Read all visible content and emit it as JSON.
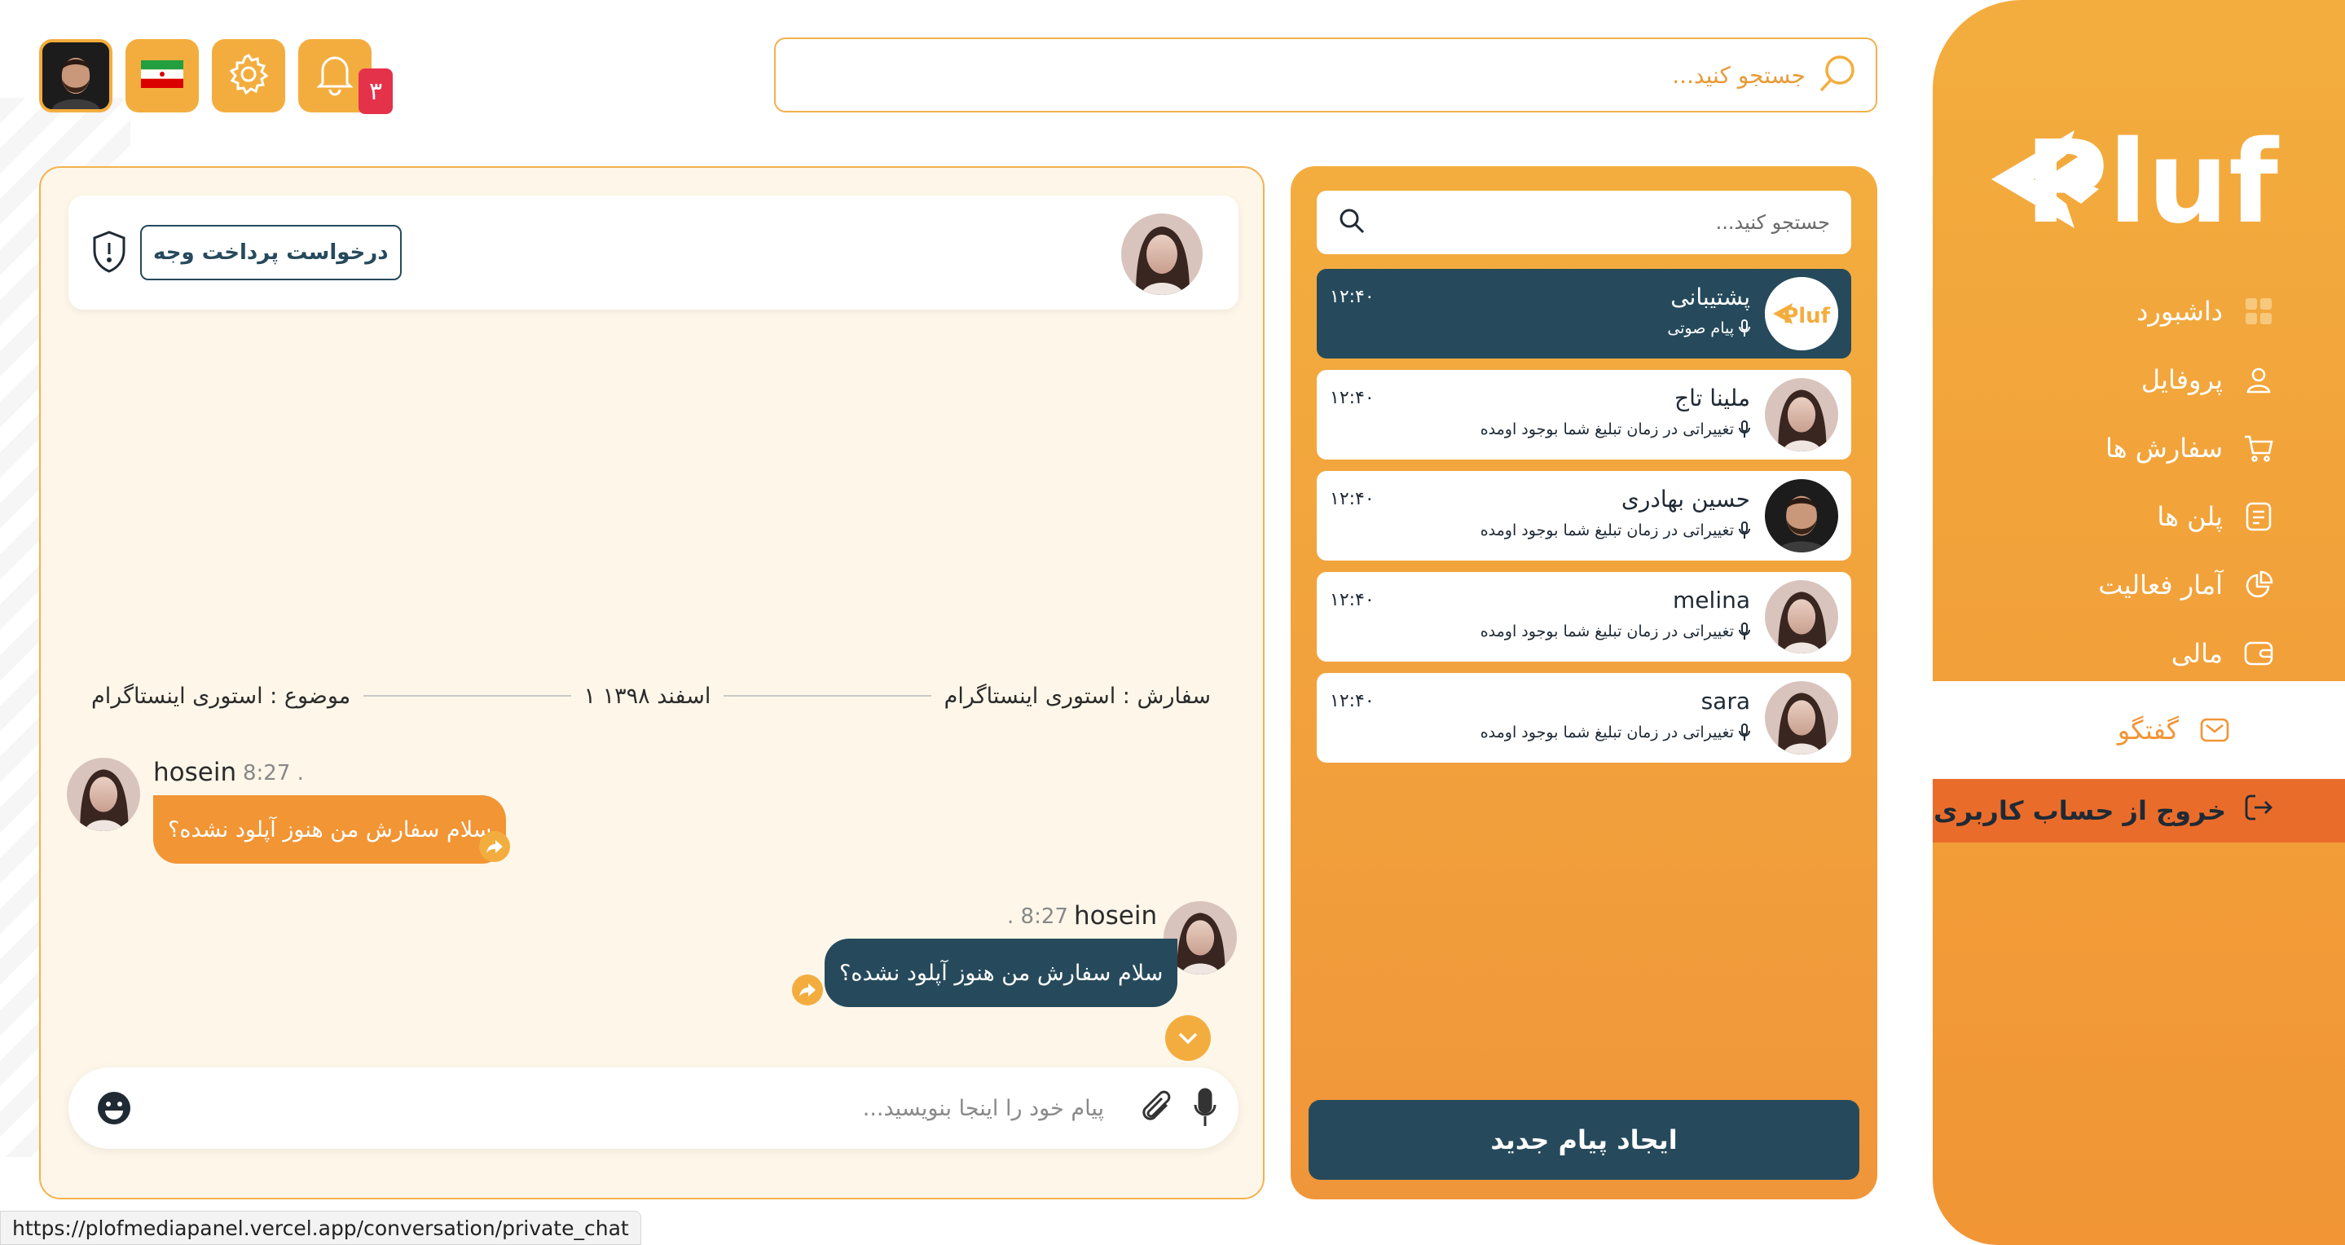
{
  "brand": {
    "logo_text": "Pluf"
  },
  "topbar": {
    "search_placeholder": "جستجو کنید...",
    "notification_count": "۳"
  },
  "sidebar": {
    "items": [
      {
        "label": "داشبورد",
        "icon": "dashboard-icon"
      },
      {
        "label": "پروفایل",
        "icon": "user-icon"
      },
      {
        "label": "سفارش ها",
        "icon": "cart-icon"
      },
      {
        "label": "پلن ها",
        "icon": "document-icon"
      },
      {
        "label": "آمار فعالیت",
        "icon": "pie-chart-icon"
      },
      {
        "label": "مالی",
        "icon": "wallet-icon"
      },
      {
        "label": "گفتگو",
        "icon": "mail-icon",
        "active": true
      }
    ],
    "logout": "خروج از حساب کاربری"
  },
  "chat_list": {
    "search_placeholder": "جستجو کنید...",
    "conversations": [
      {
        "name": "پشتیبانی",
        "preview": "پیام صوتی",
        "time": "۱۲:۴۰",
        "active": true
      },
      {
        "name": "ملینا تاج",
        "preview": "تغییراتی در زمان تبلیغ شما بوجود اومده",
        "time": "۱۲:۴۰"
      },
      {
        "name": "حسین بهادری",
        "preview": "تغییراتی در زمان تبلیغ شما بوجود اومده",
        "time": "۱۲:۴۰"
      },
      {
        "name": "melina",
        "preview": "تغییراتی در زمان تبلیغ شما بوجود اومده",
        "time": "۱۲:۴۰"
      },
      {
        "name": "sara",
        "preview": "تغییراتی در زمان تبلیغ شما بوجود اومده",
        "time": "۱۲:۴۰"
      }
    ],
    "new_message_button": "ایجاد پیام جدید"
  },
  "chat": {
    "payment_request_button": "درخواست پرداخت وجه",
    "order": "سفارش : استوری اینستاگرام",
    "date": "۱ اسفند ۱۳۹۸",
    "subject": "موضوع : استوری اینستاگرام",
    "messages": [
      {
        "name": "hosein",
        "time": "8:27 .",
        "text": "سلام سفارش من هنوز آپلود نشده؟",
        "direction": "incoming"
      },
      {
        "name": "hosein",
        "time": ". 8:27",
        "text": "سلام سفارش من هنوز آپلود نشده؟",
        "direction": "outgoing"
      }
    ],
    "composer_placeholder": "پیام خود را اینجا بنویسید..."
  },
  "status_url": "https://plofmediapanel.vercel.app/conversation/private_chat",
  "colors": {
    "primary": "#f3ad3e",
    "accent_dark": "#264a5c",
    "logout_bg": "#ea6c2b",
    "badge": "#e4324b"
  }
}
